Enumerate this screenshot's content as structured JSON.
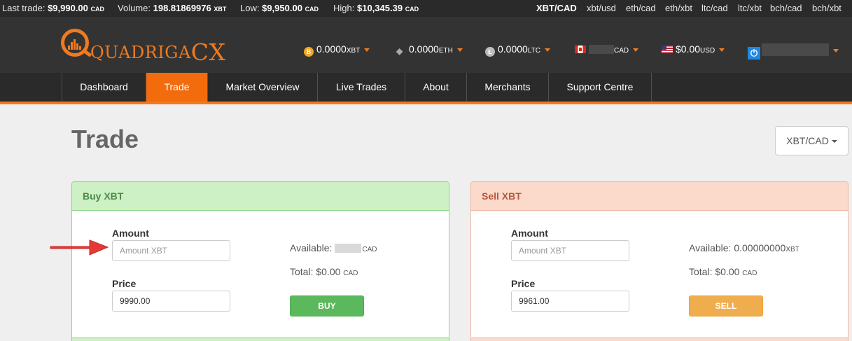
{
  "ticker": {
    "last_label": "Last trade:",
    "last_value": "$9,990.00",
    "last_unit": "CAD",
    "volume_label": "Volume:",
    "volume_value": "198.81869976",
    "volume_unit": "XBT",
    "low_label": "Low:",
    "low_value": "$9,950.00",
    "low_unit": "CAD",
    "high_label": "High:",
    "high_value": "$10,345.39",
    "high_unit": "CAD",
    "pairs": [
      "XBT/CAD",
      "xbt/usd",
      "eth/cad",
      "eth/xbt",
      "ltc/cad",
      "ltc/xbt",
      "bch/cad",
      "bch/xbt"
    ],
    "active_pair": "XBT/CAD"
  },
  "header": {
    "logo_text": "QUADRIGA",
    "logo_suffix": "CX",
    "balances": [
      {
        "icon": "bitcoin-icon",
        "value": "0.0000",
        "unit": "XBT"
      },
      {
        "icon": "ether-icon",
        "value": "0.0000",
        "unit": "ETH"
      },
      {
        "icon": "litecoin-icon",
        "value": "0.0000",
        "unit": "LTC"
      },
      {
        "icon": "canada-flag-icon",
        "value": "",
        "unit": "CAD"
      },
      {
        "icon": "usa-flag-icon",
        "value": "$0.00",
        "unit": "USD"
      }
    ],
    "power_icon": "power-icon"
  },
  "nav": {
    "tabs": [
      "Dashboard",
      "Trade",
      "Market Overview",
      "Live Trades",
      "About",
      "Merchants",
      "Support Centre"
    ],
    "active": "Trade"
  },
  "page": {
    "title": "Trade",
    "pair_selector": "XBT/CAD"
  },
  "buy": {
    "header": "Buy XBT",
    "amount_label": "Amount",
    "amount_placeholder": "Amount XBT",
    "amount_value": "",
    "price_label": "Price",
    "price_value": "9990.00",
    "available_label": "Available:",
    "available_value": "",
    "available_unit": "CAD",
    "total_label": "Total:",
    "total_value": "$0.00",
    "total_unit": "CAD",
    "button": "BUY"
  },
  "sell": {
    "header": "Sell XBT",
    "amount_label": "Amount",
    "amount_placeholder": "Amount XBT",
    "amount_value": "",
    "price_label": "Price",
    "price_value": "9961.00",
    "available_label": "Available:",
    "available_value": "0.00000000",
    "available_unit": "XBT",
    "total_label": "Total:",
    "total_value": "$0.00",
    "total_unit": "CAD",
    "button": "SELL"
  },
  "colors": {
    "accent": "#f26c0d",
    "buy_green": "#5cb85c",
    "sell_orange": "#f0ad4e",
    "annotation_arrow": "#e53935"
  }
}
